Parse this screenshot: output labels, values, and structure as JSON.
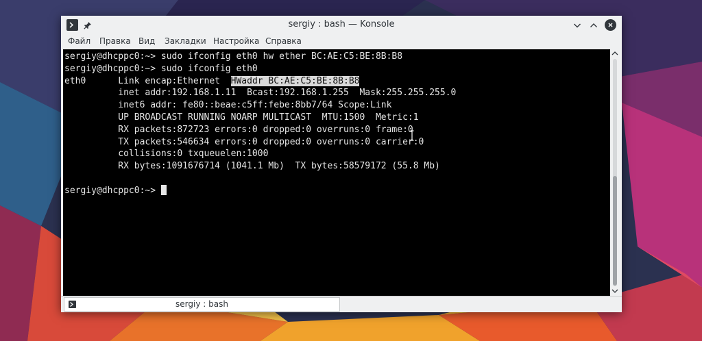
{
  "window": {
    "title": "sergiy : bash — Konsole"
  },
  "menu": {
    "items": [
      "Файл",
      "Правка",
      "Вид",
      "Закладки",
      "Настройка",
      "Справка"
    ]
  },
  "terminal": {
    "lines": [
      {
        "pre": "sergiy@dhcppc0:~> sudo ifconfig eth0 hw ether BC:AE:C5:BE:8B:B8"
      },
      {
        "pre": "sergiy@dhcppc0:~> sudo ifconfig eth0"
      },
      {
        "pre": "eth0      Link encap:Ethernet  ",
        "highlight": "HWaddr BC:AE:C5:BE:8B:B8"
      },
      {
        "pre": "          inet addr:192.168.1.11  Bcast:192.168.1.255  Mask:255.255.255.0"
      },
      {
        "pre": "          inet6 addr: fe80::beae:c5ff:febe:8bb7/64 Scope:Link"
      },
      {
        "pre": "          UP BROADCAST RUNNING NOARP MULTICAST  MTU:1500  Metric:1"
      },
      {
        "pre": "          RX packets:872723 errors:0 dropped:0 overruns:0 frame:0"
      },
      {
        "pre": "          TX packets:546634 errors:0 dropped:0 overruns:0 carrier:0"
      },
      {
        "pre": "          collisions:0 txqueuelen:1000"
      },
      {
        "pre": "          RX bytes:1091676714 (1041.1 Mb)  TX bytes:58579172 (55.8 Mb)"
      },
      {
        "pre": ""
      },
      {
        "pre": "sergiy@dhcppc0:~> ",
        "cursor": true
      }
    ]
  },
  "tabs": [
    {
      "label": "sergiy : bash"
    }
  ],
  "icons": {
    "app": "terminal-icon",
    "pin": "pin-icon",
    "minimize": "chevron-down-icon",
    "maximize": "chevron-up-icon",
    "close": "close-icon"
  },
  "colors": {
    "terminal_bg": "#000000",
    "terminal_fg": "#e6e6e6",
    "selection_bg": "#d9d9d9",
    "chrome_bg": "#eff0f1"
  }
}
